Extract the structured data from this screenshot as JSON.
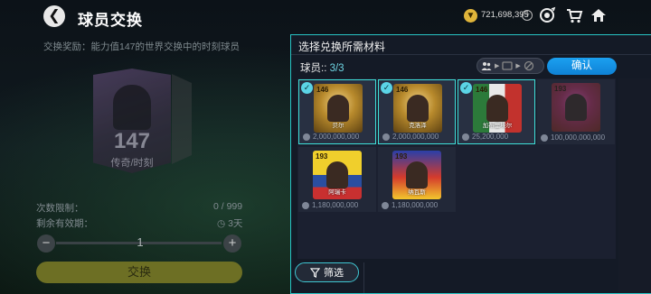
{
  "header": {
    "back_glyph": "❮",
    "title": "球员交换",
    "coin_amount": "721,698,395",
    "coin_plus": "+",
    "icons": [
      "target-icon",
      "cart-icon",
      "home-icon"
    ]
  },
  "left_panel": {
    "reward_label": "交换奖励：能力值147的世界交换中的时刻球员",
    "card_rating": "147",
    "card_type": "传奇/时刻",
    "limit_label": "次数限制：",
    "limit_value": "0 / 999",
    "validity_label": "剩余有效期：",
    "validity_value": "3天",
    "quantity": "1",
    "minus": "−",
    "plus": "+",
    "exchange_button": "交换",
    "under_label": "交"
  },
  "modal": {
    "title": "选择兑换所需材料",
    "count_label": "球员:: ",
    "count_value": "3/3",
    "confirm_button": "确认",
    "filter_button": "筛选",
    "cards": [
      {
        "rating": "146",
        "name": "贝尔",
        "price": "2,000,000,000",
        "selected": true,
        "style": "mc-gold"
      },
      {
        "rating": "146",
        "name": "克洛泽",
        "price": "2,000,000,000",
        "selected": true,
        "style": "mc-gold"
      },
      {
        "rating": "146",
        "name": "加布里埃尔",
        "price": "25,200,000",
        "selected": true,
        "style": "mc-green"
      },
      {
        "rating": "193",
        "name": "",
        "price": "100,000,000,000",
        "selected": false,
        "style": "mc-red"
      },
      {
        "rating": "193",
        "name": "阿瑞卡",
        "price": "1,180,000,000",
        "selected": false,
        "style": "mc-yellow"
      },
      {
        "rating": "193",
        "name": "纳瓦斯",
        "price": "1,180,000,000",
        "selected": false,
        "style": "mc-flag"
      }
    ]
  },
  "colors": {
    "accent_cyan": "#3ee0d8",
    "confirm_blue": "#1490e0",
    "exchange_olive": "#6d6f24",
    "coin_gold": "#e0b53a"
  }
}
